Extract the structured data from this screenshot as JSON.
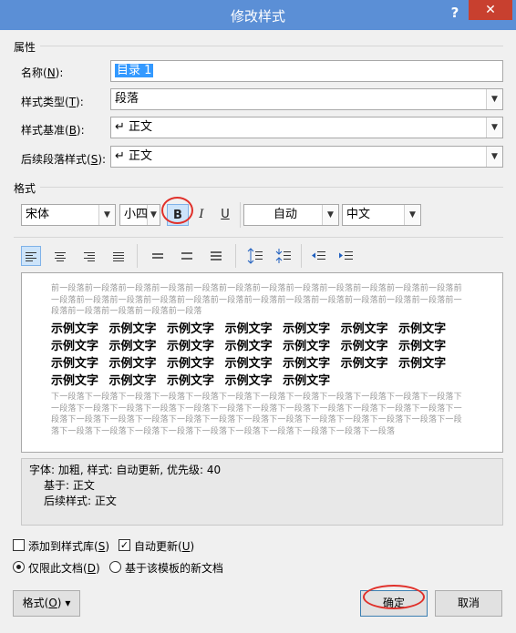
{
  "window": {
    "title": "修改样式",
    "help": "?",
    "close": "✕"
  },
  "properties": {
    "section": "属性",
    "name_label": "名称(",
    "name_key": "N",
    "name_tail": "):",
    "name_value": "目录 1",
    "type_label": "样式类型(",
    "type_key": "T",
    "type_tail": "):",
    "type_value": "段落",
    "based_label": "样式基准(",
    "based_key": "B",
    "based_tail": "):",
    "based_value": "↵ 正文",
    "next_label": "后续段落样式(",
    "next_key": "S",
    "next_tail": "):",
    "next_value": "↵ 正文"
  },
  "format": {
    "section": "格式",
    "font": "宋体",
    "size": "小四",
    "bold": "B",
    "italic": "I",
    "underline": "U",
    "color": "自动",
    "script": "中文"
  },
  "preview": {
    "prev_para": "前一段落前一段落前一段落前一段落前一段落前一段落前一段落前一段落前一段落前一段落前一段落前一段落前一段落前一段落前一段落前一段落前一段落前一段落前一段落前一段落前一段落前一段落前一段落前一段落前一段落前一段落前一段落前一段落前一段落",
    "sample_lines": [
      "示例文字 示例文字 示例文字 示例文字 示例文字 示例文字 示例文字",
      "示例文字 示例文字 示例文字 示例文字 示例文字 示例文字 示例文字",
      "示例文字 示例文字 示例文字 示例文字 示例文字 示例文字 示例文字",
      "示例文字 示例文字 示例文字 示例文字 示例文字"
    ],
    "next_para": "下一段落下一段落下一段落下一段落下一段落下一段落下一段落下一段落下一段落下一段落下一段落下一段落下一段落下一段落下一段落下一段落下一段落下一段落下一段落下一段落下一段落下一段落下一段落下一段落下一段落下一段落下一段落下一段落下一段落下一段落下一段落下一段落下一段落下一段落下一段落下一段落下一段落下一段落下一段落下一段落下一段落下一段落下一段落下一段落下一段落下一段落下一段落"
  },
  "description": {
    "line1": "字体: 加粗, 样式: 自动更新, 优先级: 40",
    "line2": "基于: 正文",
    "line3": "后续样式: 正文"
  },
  "options": {
    "add_gallery": "添加到样式库(",
    "add_gallery_key": "S",
    "add_gallery_tail": ")",
    "auto_update": "自动更新(",
    "auto_update_key": "U",
    "auto_update_tail": ")",
    "only_doc": "仅限此文档(",
    "only_doc_key": "D",
    "only_doc_tail": ")",
    "new_docs": "基于该模板的新文档"
  },
  "buttons": {
    "format": "格式(",
    "format_key": "O",
    "format_tail": ")",
    "format_arrow": "▾",
    "ok": "确定",
    "cancel": "取消"
  },
  "colors": {
    "titlebar": "#5b8fd6",
    "close": "#c8402f",
    "annotation": "#e0302a",
    "selection": "#3399ff"
  }
}
